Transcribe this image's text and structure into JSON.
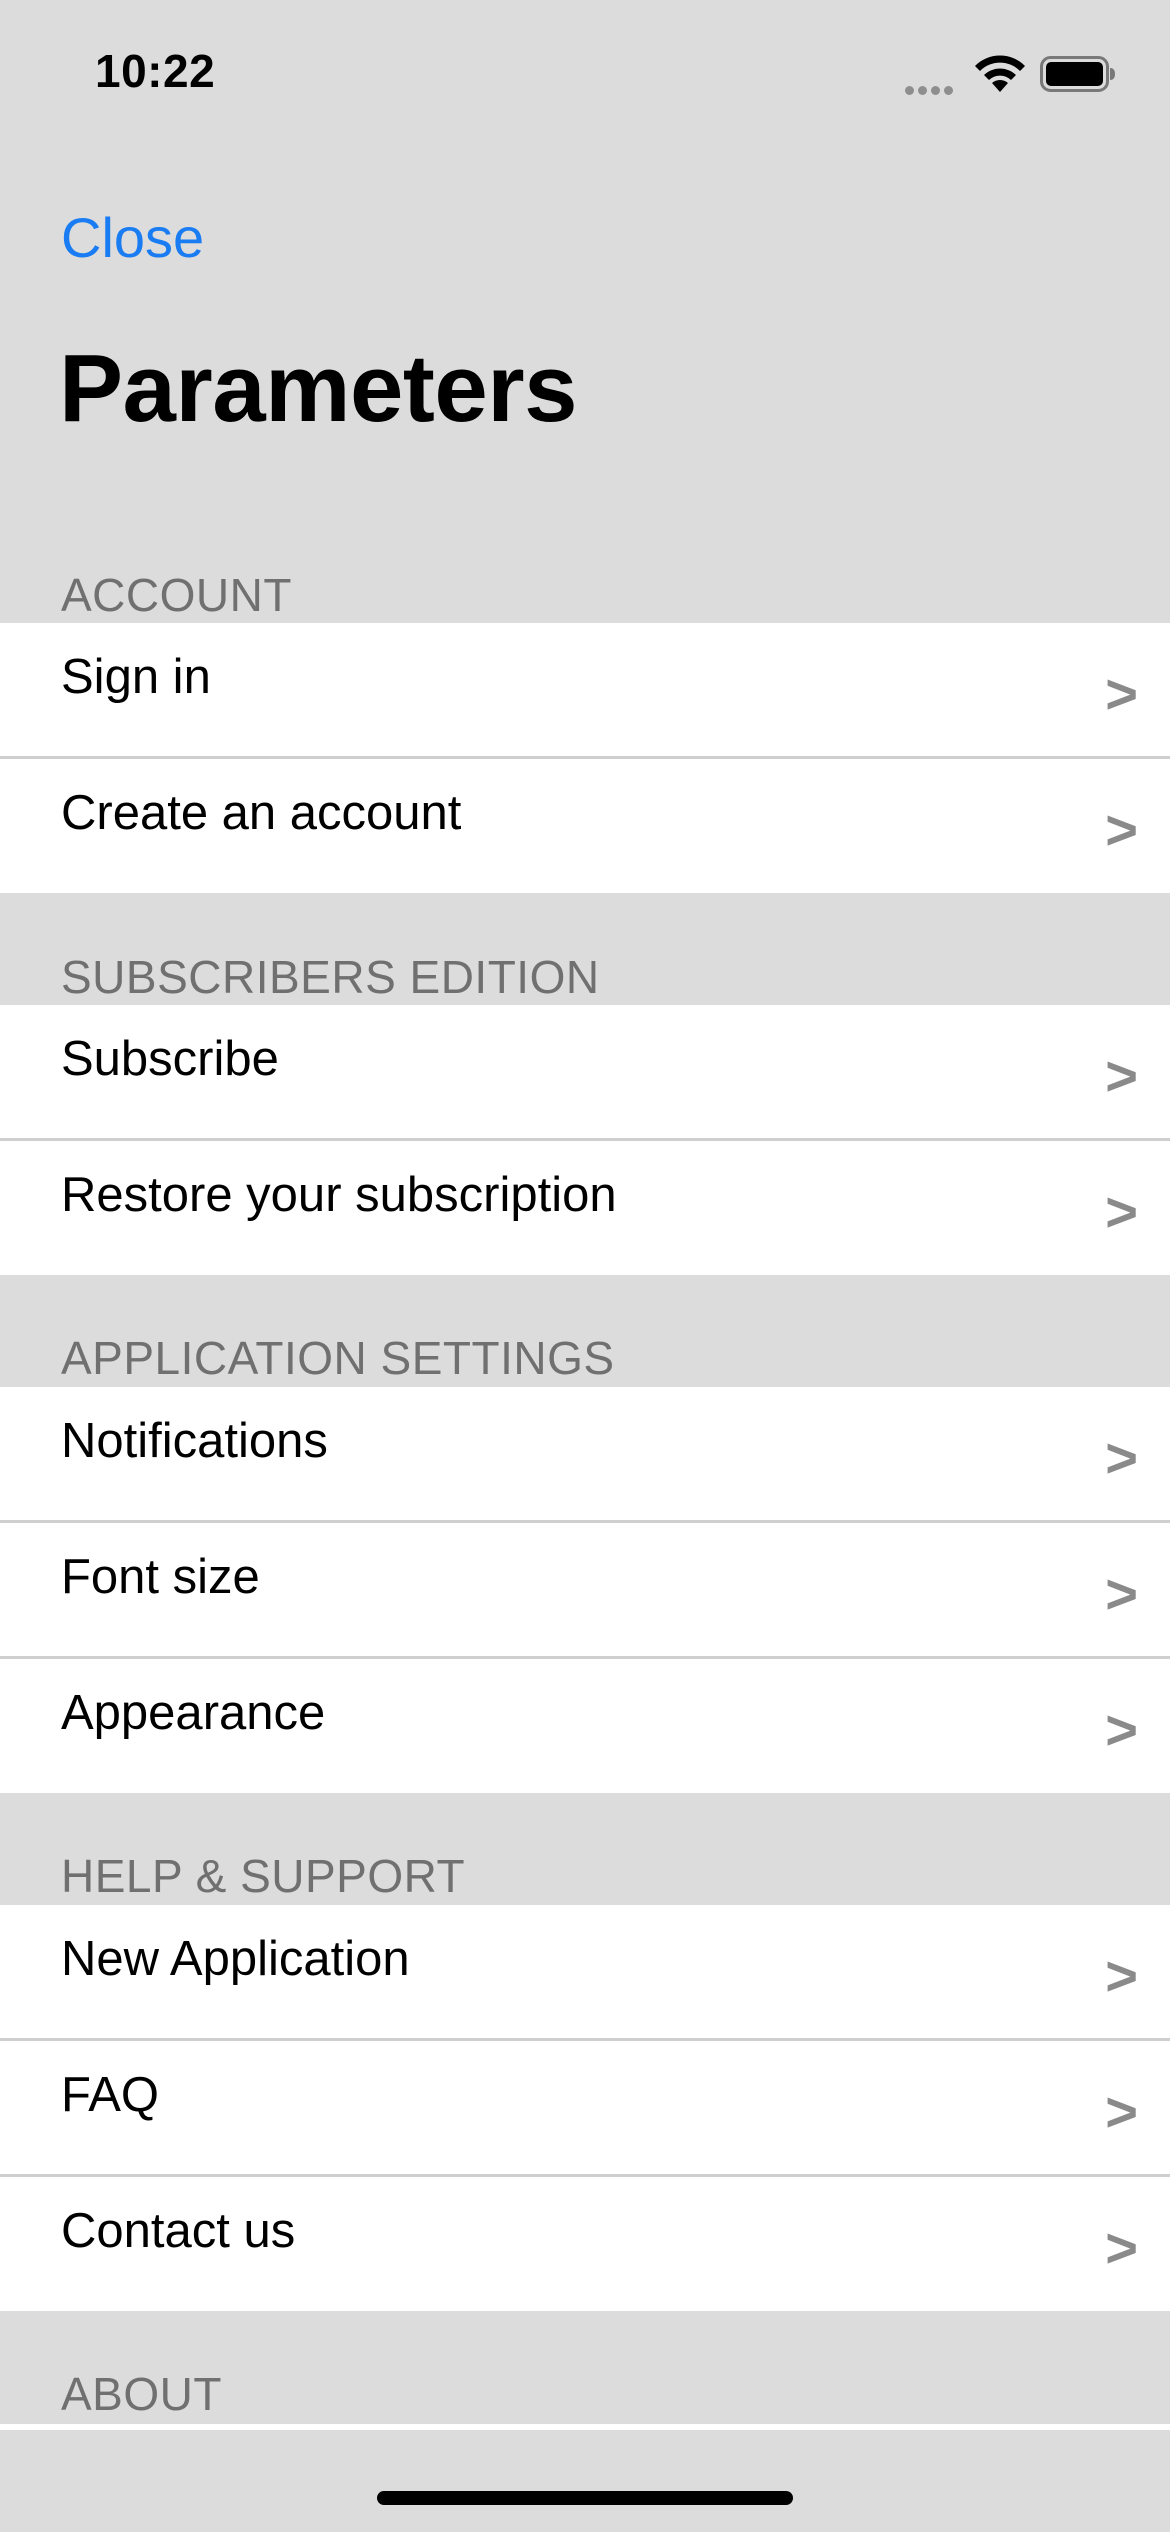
{
  "status_bar": {
    "time": "10:22"
  },
  "nav": {
    "close_label": "Close",
    "title": "Parameters"
  },
  "colors": {
    "accent": "#1a7cf2",
    "background": "#dcdcdc",
    "row_background": "#ffffff",
    "section_header": "#707070",
    "chevron": "#8a8a8a"
  },
  "sections": [
    {
      "header": "ACCOUNT",
      "items": [
        {
          "label": "Sign in",
          "chevron": ">"
        },
        {
          "label": "Create an account",
          "chevron": ">"
        }
      ]
    },
    {
      "header": "SUBSCRIBERS EDITION",
      "items": [
        {
          "label": "Subscribe",
          "chevron": ">"
        },
        {
          "label": "Restore your subscription",
          "chevron": ">"
        }
      ]
    },
    {
      "header": "APPLICATION SETTINGS",
      "items": [
        {
          "label": "Notifications",
          "chevron": ">"
        },
        {
          "label": "Font size",
          "chevron": ">"
        },
        {
          "label": "Appearance",
          "chevron": ">"
        }
      ]
    },
    {
      "header": "HELP & SUPPORT",
      "items": [
        {
          "label": "New Application",
          "chevron": ">"
        },
        {
          "label": "FAQ",
          "chevron": ">"
        },
        {
          "label": "Contact us",
          "chevron": ">"
        }
      ]
    },
    {
      "header": "ABOUT",
      "items": []
    }
  ],
  "icons": {
    "signal": "cellular-signal-icon",
    "wifi": "wifi-icon",
    "battery": "battery-icon"
  }
}
